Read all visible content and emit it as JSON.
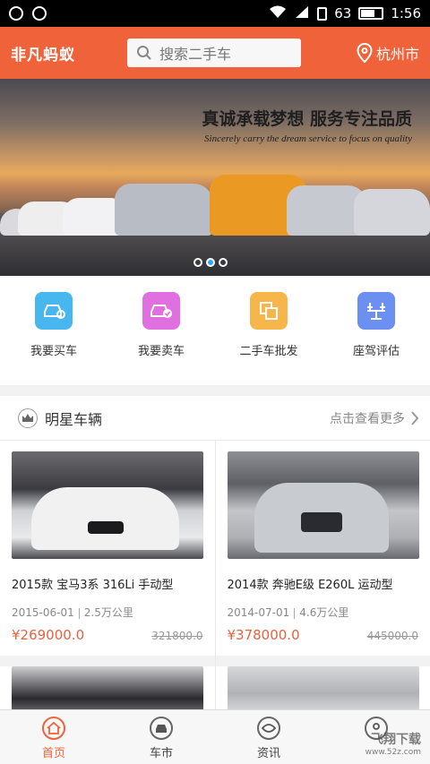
{
  "status_bar": {
    "battery": "63",
    "time": "1:56"
  },
  "header": {
    "logo": "非凡蚂蚁",
    "search_placeholder": "搜索二手车",
    "city": "杭州市"
  },
  "banner": {
    "slogan_main": "真诚承载梦想 服务专注品质",
    "slogan_sub": "Sincerely carry the dream service to focus on quality",
    "active_dot": 1
  },
  "menu": {
    "items": [
      {
        "label": "我要买车",
        "icon": "buy-car-icon",
        "color": "#49b7ef"
      },
      {
        "label": "我要卖车",
        "icon": "sell-car-icon",
        "color": "#e06fe0"
      },
      {
        "label": "二手车批发",
        "icon": "wholesale-icon",
        "color": "#f6b64b"
      },
      {
        "label": "座驾评估",
        "icon": "evaluation-icon",
        "color": "#6c8ff2"
      }
    ]
  },
  "featured": {
    "title": "明星车辆",
    "more": "点击查看更多",
    "cars": [
      {
        "title": "2015款 宝马3系 316Li 手动型",
        "date": "2015-06-01",
        "mileage": "2.5万公里",
        "price": "¥269000.0",
        "original_price": "321800.0"
      },
      {
        "title": "2014款 奔驰E级 E260L 运动型",
        "date": "2014-07-01",
        "mileage": "4.6万公里",
        "price": "¥378000.0",
        "original_price": "445000.0"
      }
    ]
  },
  "tabs": [
    {
      "label": "首页",
      "icon": "home-icon",
      "active": true
    },
    {
      "label": "车市",
      "icon": "car-market-icon",
      "active": false
    },
    {
      "label": "资讯",
      "icon": "news-icon",
      "active": false
    },
    {
      "label": "",
      "icon": "profile-icon",
      "active": false
    }
  ],
  "watermark": {
    "text": "飞翔下载",
    "url": "www.52z.com"
  },
  "colors": {
    "brand": "#f0623a",
    "price": "#e8623e",
    "dot_active": "#2aa6ff"
  }
}
